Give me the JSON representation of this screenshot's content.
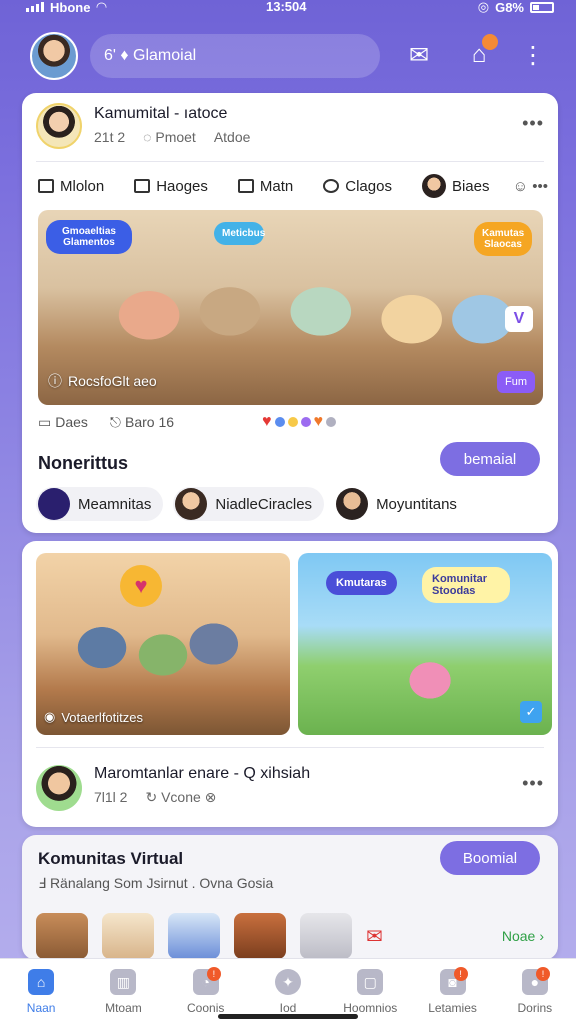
{
  "status": {
    "carrier": "Hbone",
    "time": "13:504",
    "battery": "G8%"
  },
  "header": {
    "search_text": "6' ♦ Glamoial"
  },
  "post1": {
    "author": "Kamumital - ıatoce",
    "meta_time": "21t 2",
    "meta_a": "Pmoet",
    "meta_b": "Atdoe",
    "tabs": [
      "Mlolon",
      "Haoges",
      "Matn",
      "Clagos",
      "Biaes"
    ],
    "hero_bubbles": [
      "Gmoaeltias Glamentos",
      "Meticbus",
      "Kamutas Slaocas"
    ],
    "hero_caption": "RocsfoGlt aeo",
    "hero_badge": "Fum",
    "reactions": [
      "Daes",
      "Baro 16"
    ]
  },
  "section": {
    "title": "Nonerittus",
    "button": "bemaial",
    "chips": [
      "Meamnitas",
      "NiadleCiracles",
      "Moyuntitans"
    ]
  },
  "post2": {
    "left_caption": "Votaerlfotitzes",
    "right_bubbles": [
      "Kmutaras",
      "Komunitar Stoodas"
    ],
    "author": "Maromtanlar enare - Q xihsiah",
    "meta_time": "7l1l 2",
    "meta_a": "Vcone"
  },
  "komunitas": {
    "title": "Komunitas Virtual",
    "subtitle": "Ⅎ Ränalang Som Jsirnut . Ovna Gosia",
    "button": "Boomial",
    "new_link": "Noae"
  },
  "nav": {
    "items": [
      {
        "label": "Naan",
        "active": true
      },
      {
        "label": "Mtoam"
      },
      {
        "label": "Coonis",
        "badge": "!"
      },
      {
        "label": "Iod"
      },
      {
        "label": "Hoomnios"
      },
      {
        "label": "Letamies",
        "badge": "!"
      },
      {
        "label": "Dorins",
        "badge": "!"
      }
    ]
  },
  "colors": {
    "accent": "#7d6ee2",
    "nav_active": "#3f7de8",
    "background": "#7c70de"
  }
}
